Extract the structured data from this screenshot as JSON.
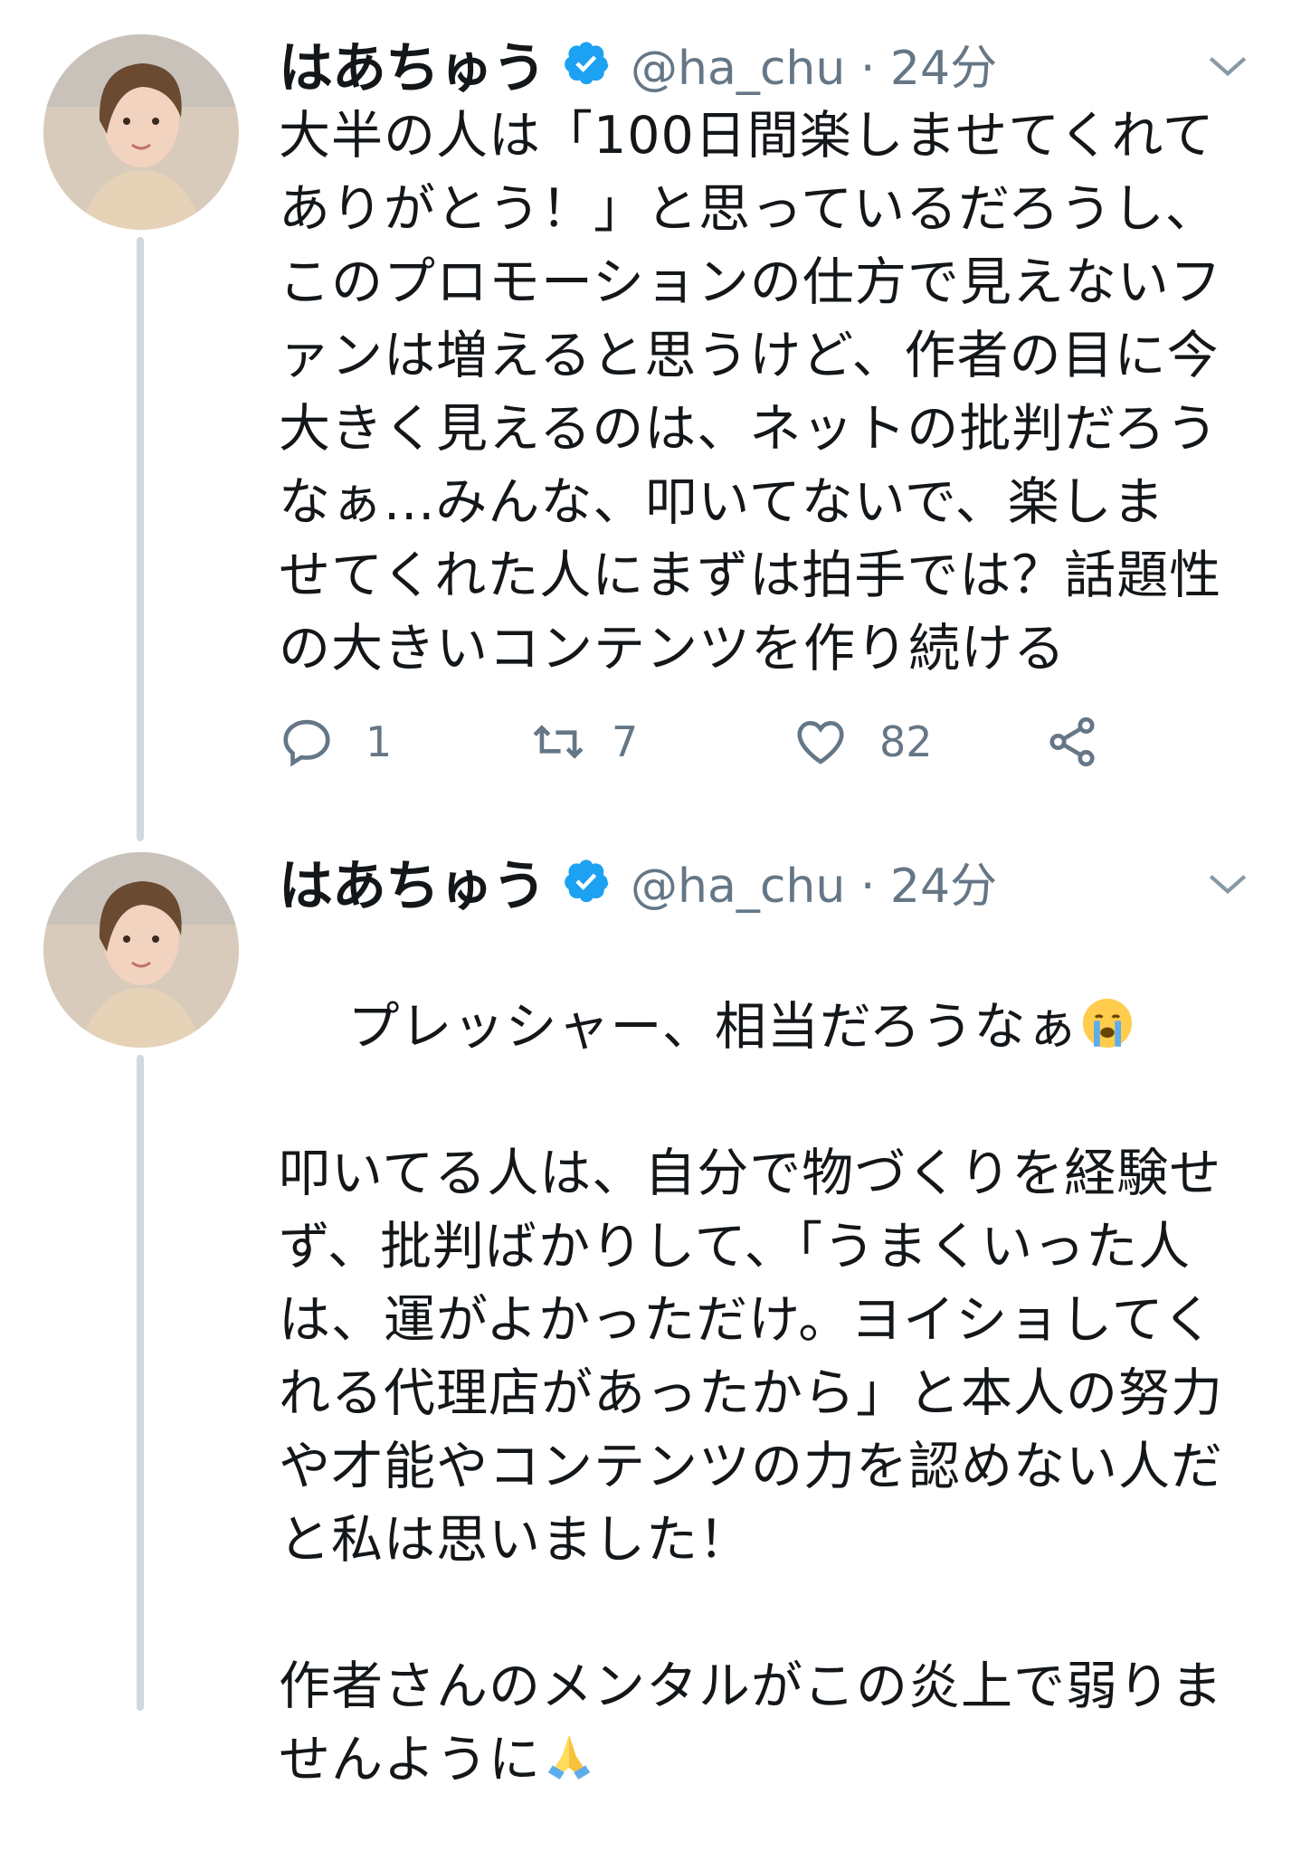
{
  "tweets": [
    {
      "name": "はあちゅう",
      "handle": "@ha_chu · 24分",
      "text": "大半の人は「100日間楽しませてくれて\nありがとう！」と思っているだろうし、\nこのプロモーションの仕方で見えないフ\nァンは増えると思うけど、作者の目に今\n大きく見えるのは、ネットの批判だろう\nなぁ...みんな、叩いてないで、楽しま\nせてくれた人にまずは拍手では？話題性\nの大きいコンテンツを作り続ける",
      "replies": "1",
      "retweets": "7",
      "likes": "82"
    },
    {
      "name": "はあちゅう",
      "handle": "@ha_chu · 24分",
      "text_line1": "プレッシャー、相当だろうなぁ",
      "text_rest": "\n\n叩いてる人は、自分で物づくりを経験せ\nず、批判ばかりして、「うまくいった人\nは、運がよかっただけ。ヨイショしてく\nれる代理店があったから」と本人の努力\nや才能やコンテンツの力を認めない人だ\nと私は思いました！\n\n作者さんのメンタルがこの炎上で弱りま\nせんように"
    }
  ],
  "colors": {
    "verified": "#1da1f2",
    "muted": "#657786",
    "thread": "#cfd9de"
  },
  "icons": [
    "verified-badge-icon",
    "caret-down-icon",
    "reply-icon",
    "retweet-icon",
    "like-icon",
    "share-icon",
    "crying-face-emoji",
    "folded-hands-emoji"
  ]
}
